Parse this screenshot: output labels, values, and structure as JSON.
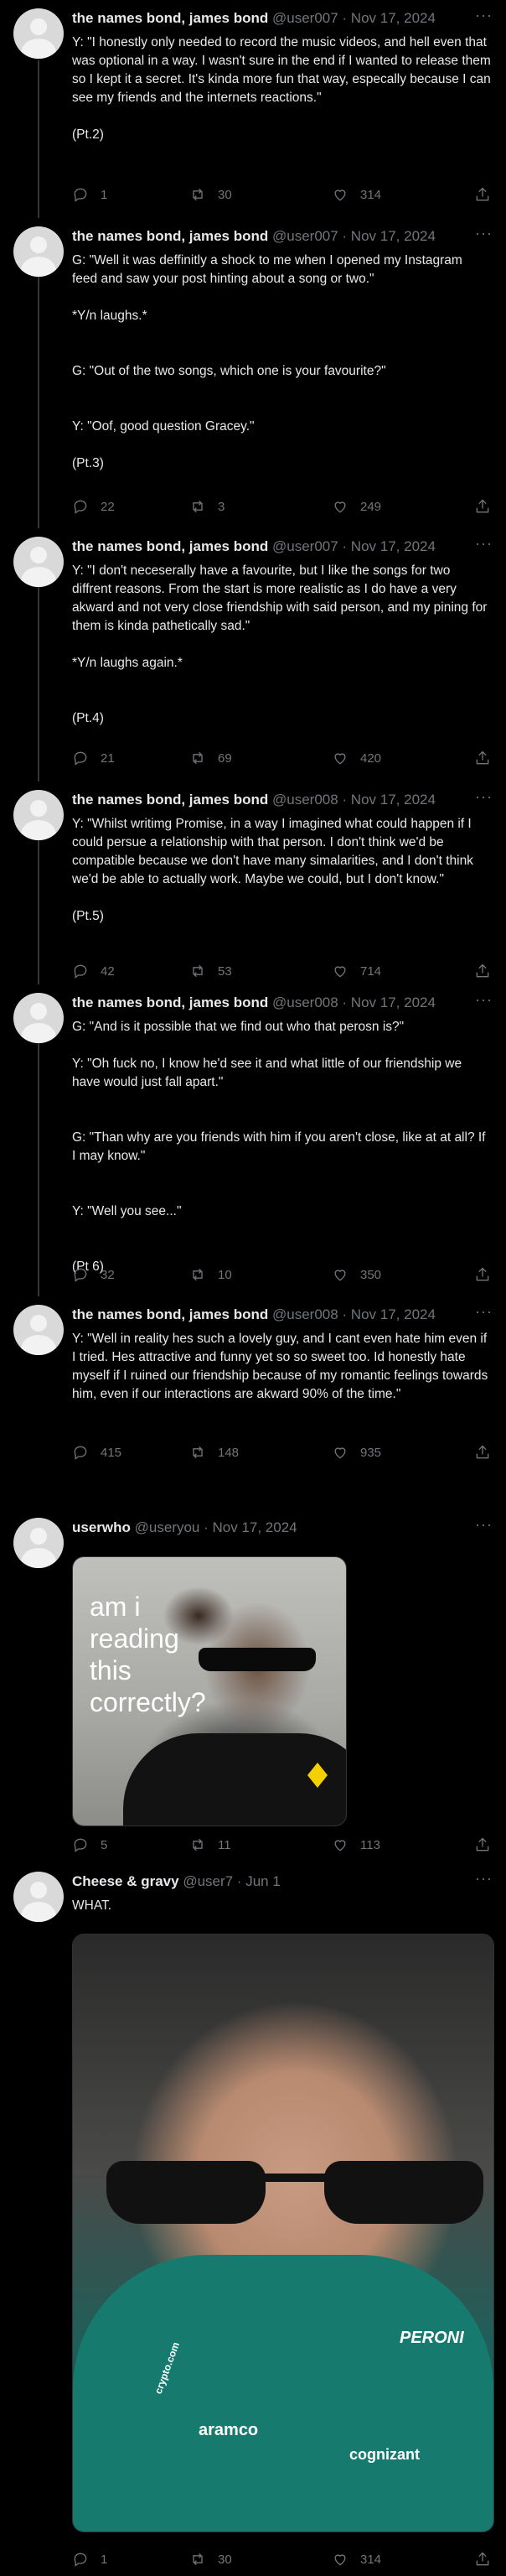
{
  "tweets": [
    {
      "name": "the names bond, james bond",
      "meta": "@user007 · Nov 17, 2024",
      "paragraphs": [
        "Y: \"I honestly only needed to record the music videos, and hell even that was optional in a way. I wasn't sure in the end if I wanted to release them so I kept it a secret. It's kinda more fun that way, especally because I can see my friends and the internets reactions.\"",
        "(Pt.2)"
      ],
      "reply_count": "1",
      "retweet_count": "30",
      "like_count": "314"
    },
    {
      "name": "the names bond, james bond",
      "meta": "@user007 · Nov 17, 2024",
      "paragraphs": [
        "G: \"Well it was deffinitly a shock to me when I opened my Instagram feed and saw your post hinting about a song or two.\"",
        "*Y/n laughs.*",
        "G: \"Out of the two songs, which one is your favourite?\"",
        "Y: \"Oof, good question Gracey.\"",
        "(Pt.3)"
      ],
      "reply_count": "22",
      "retweet_count": "3",
      "like_count": "249"
    },
    {
      "name": "the names bond, james bond",
      "meta": "@user007 · Nov 17, 2024",
      "paragraphs": [
        "Y: \"I don't neceserally have a favourite, but I like the songs for two diffrent reasons. From the start is more realistic as I do have a very akward and not very close friendship with said person, and my pining for them is kinda pathetically sad.\"",
        "*Y/n laughs again.*",
        "(Pt.4)"
      ],
      "reply_count": "21",
      "retweet_count": "69",
      "like_count": "420"
    },
    {
      "name": "the names bond, james bond",
      "meta": "@user008 · Nov 17, 2024",
      "paragraphs": [
        "Y: \"Whilst writimg Promise, in a way I imagined what could happen if I could persue a relationship with that person. I don't think we'd be compatible because we don't have many simalarities, and I don't think we'd be able to actually work. Maybe we could, but I don't know.\"",
        "(Pt.5)"
      ],
      "reply_count": "42",
      "retweet_count": "53",
      "like_count": "714"
    },
    {
      "name": "the names bond, james bond",
      "meta": "@user008 · Nov 17, 2024",
      "paragraphs": [
        "G: \"And is it possible that we find out who that perosn is?\"",
        "Y: \"Oh fuck no, I know he'd see it and what little of our friendship we have would just fall apart.\"",
        "G: \"Than why are you friends with him if you aren't close, like at at all? If I may know.\"",
        "Y: \"Well you see...\"",
        "(Pt 6)"
      ],
      "reply_count": "32",
      "retweet_count": "10",
      "like_count": "350"
    },
    {
      "name": "the names bond, james bond",
      "meta": "@user008 · Nov 17, 2024",
      "paragraphs": [
        "Y: \"Well in reality hes such a lovely guy, and I cant even hate him even if I tried. Hes attractive and funny yet so so sweet too. Id honestly hate myself if I ruined our friendship because of my romantic feelings towards him, even if our interactions are akward 90% of the time.\""
      ],
      "reply_count": "415",
      "retweet_count": "148",
      "like_count": "935"
    },
    {
      "name": "userwho",
      "meta": "@useryou · Nov 17, 2024",
      "paragraphs": [],
      "image_text": "am i reading this correctly?",
      "reply_count": "5",
      "retweet_count": "11",
      "like_count": "113"
    },
    {
      "name": "Cheese & gravy",
      "meta": "@user7 · Jun 1",
      "paragraphs": [
        "WHAT."
      ],
      "image_brand_text": [
        "PERONI",
        "aramco",
        "cognizant",
        "crypto.com"
      ],
      "reply_count": "1",
      "retweet_count": "30",
      "like_count": "314"
    }
  ],
  "more_glyph": "···"
}
